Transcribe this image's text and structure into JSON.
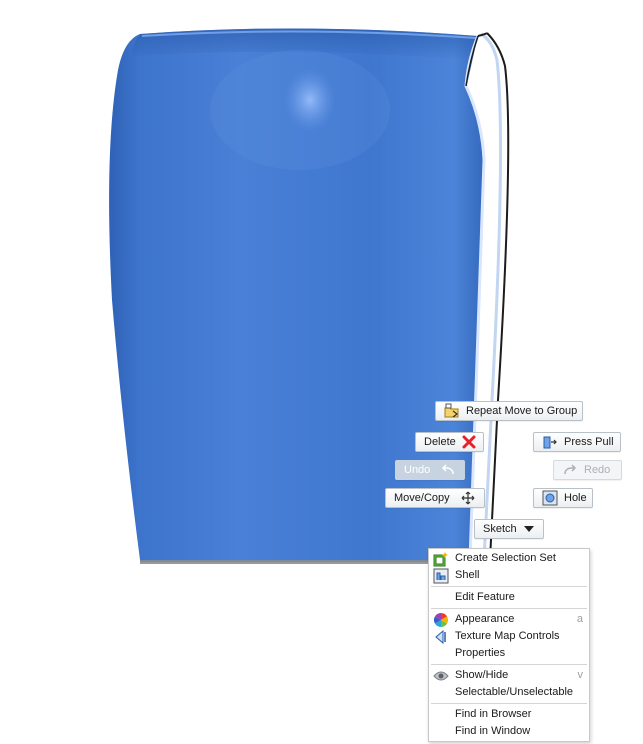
{
  "marking_menu": {
    "repeat_move": "Repeat Move to Group",
    "delete": "Delete",
    "press_pull": "Press Pull",
    "undo": "Undo",
    "redo": "Redo",
    "move_copy": "Move/Copy",
    "hole": "Hole",
    "sketch": "Sketch"
  },
  "context_menu": {
    "items": [
      {
        "label": "Create Selection Set",
        "icon": "selection-set-icon",
        "shortcut": ""
      },
      {
        "label": "Shell",
        "icon": "shell-icon",
        "shortcut": ""
      },
      {
        "label": "Edit Feature",
        "icon": "",
        "shortcut": ""
      },
      {
        "label": "Appearance",
        "icon": "appearance-icon",
        "shortcut": "a"
      },
      {
        "label": "Texture Map Controls",
        "icon": "texture-map-icon",
        "shortcut": ""
      },
      {
        "label": "Properties",
        "icon": "",
        "shortcut": ""
      },
      {
        "label": "Show/Hide",
        "icon": "eye-icon",
        "shortcut": "v"
      },
      {
        "label": "Selectable/Unselectable",
        "icon": "",
        "shortcut": ""
      },
      {
        "label": "Find in Browser",
        "icon": "",
        "shortcut": ""
      },
      {
        "label": "Find in Window",
        "icon": "",
        "shortcut": ""
      }
    ]
  },
  "colors": {
    "body_blue": "#3f78cc",
    "body_highlight": "#8fb6ff",
    "delete_red": "#e8202a"
  }
}
